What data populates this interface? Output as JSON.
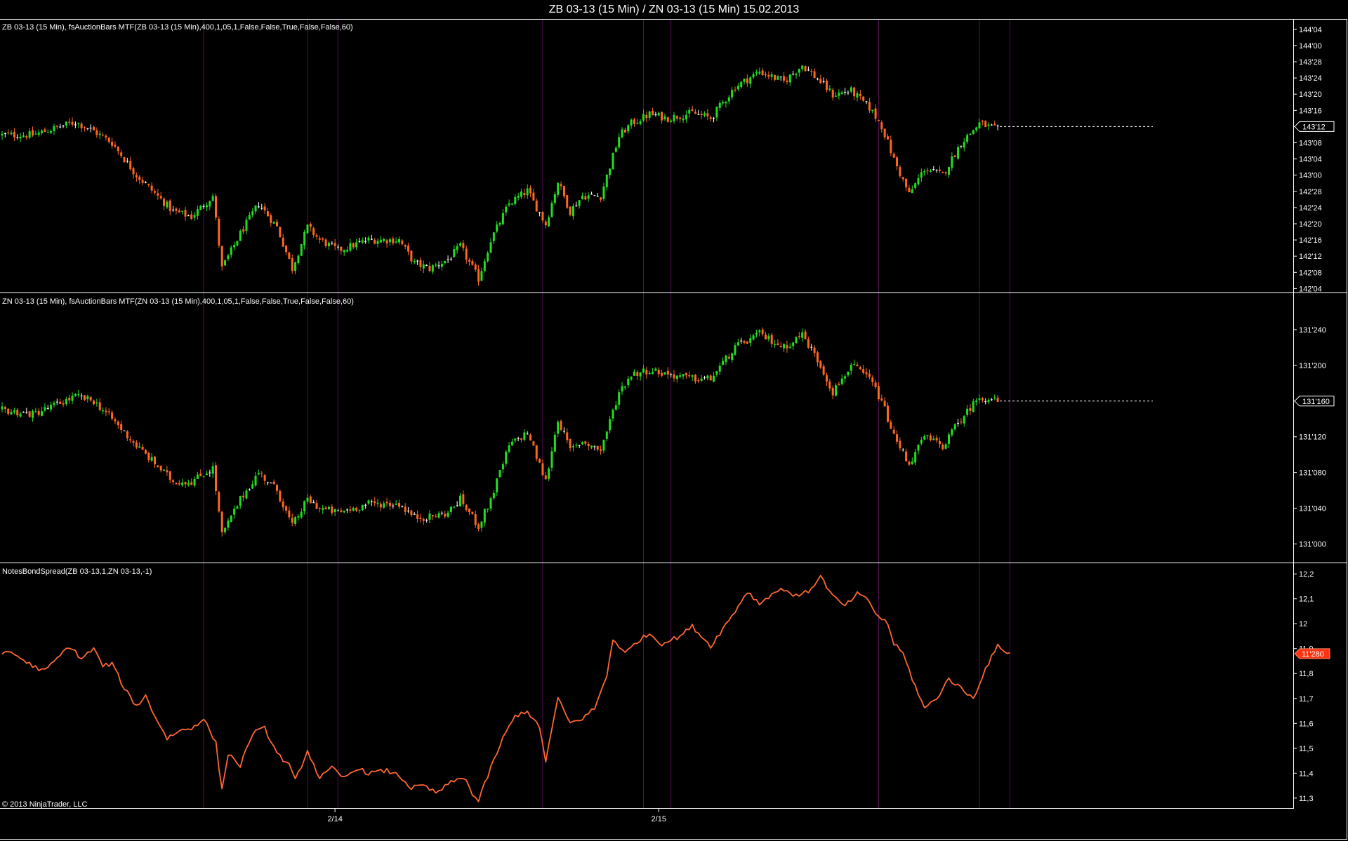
{
  "window": {
    "title": "ZB 03-13 (15 Min) / ZN 03-13 (15 Min)  15.02.2013"
  },
  "colors": {
    "background": "#000000",
    "border": "#ffffff",
    "separator": "#551155",
    "up_bar": "#22dd22",
    "down_bar": "#ff6622",
    "neutral_bar": "#ffffff",
    "spread_line": "#ff6633",
    "spread_marker_bg": "#ff3311"
  },
  "copyright": "© 2013 NinjaTrader, LLC",
  "x_axis": {
    "labels": [
      {
        "text": "2/14",
        "index": 109
      },
      {
        "text": "2/15",
        "index": 215
      }
    ],
    "session_separators": [
      66,
      100,
      110,
      177,
      210,
      219,
      287,
      320,
      330
    ]
  },
  "chart_data": [
    {
      "type": "candlestick",
      "name": "ZB 03-13 (15 Min), fsAuctionBars MTF(ZB 03-13 (15 Min),400,1,05,1,False,False,True,False,False,60)",
      "ylim": [
        142.1,
        144.2
      ],
      "tick_values": [
        142.125,
        142.25,
        142.375,
        142.5,
        142.625,
        142.75,
        142.875,
        143.0,
        143.125,
        143.25,
        143.375,
        143.5,
        143.625,
        143.75,
        143.875,
        144.0,
        144.125
      ],
      "tick_labels": [
        "142'04",
        "142'08",
        "142'12",
        "142'16",
        "142'20",
        "142'24",
        "142'28",
        "143'00",
        "143'04",
        "143'08",
        "143'12",
        "143'16",
        "143'20",
        "143'24",
        "143'28",
        "144'00",
        "144'04"
      ],
      "last_price": 143.375,
      "last_label": "143'12",
      "keys": [
        [
          0,
          143.31
        ],
        [
          10,
          143.31
        ],
        [
          24,
          143.41
        ],
        [
          30,
          143.34
        ],
        [
          36,
          143.25
        ],
        [
          44,
          143.0
        ],
        [
          56,
          142.72
        ],
        [
          62,
          142.68
        ],
        [
          69,
          142.84
        ],
        [
          72,
          142.28
        ],
        [
          78,
          142.55
        ],
        [
          84,
          142.78
        ],
        [
          90,
          142.6
        ],
        [
          95,
          142.28
        ],
        [
          100,
          142.6
        ],
        [
          104,
          142.5
        ],
        [
          110,
          142.42
        ],
        [
          120,
          142.5
        ],
        [
          130,
          142.5
        ],
        [
          135,
          142.32
        ],
        [
          140,
          142.28
        ],
        [
          146,
          142.35
        ],
        [
          150,
          142.45
        ],
        [
          156,
          142.2
        ],
        [
          160,
          142.5
        ],
        [
          166,
          142.78
        ],
        [
          172,
          142.88
        ],
        [
          178,
          142.62
        ],
        [
          182,
          142.95
        ],
        [
          186,
          142.72
        ],
        [
          190,
          142.84
        ],
        [
          196,
          142.84
        ],
        [
          202,
          143.3
        ],
        [
          206,
          143.4
        ],
        [
          212,
          143.47
        ],
        [
          218,
          143.44
        ],
        [
          226,
          143.48
        ],
        [
          232,
          143.44
        ],
        [
          240,
          143.68
        ],
        [
          248,
          143.8
        ],
        [
          256,
          143.72
        ],
        [
          262,
          143.85
        ],
        [
          268,
          143.72
        ],
        [
          272,
          143.62
        ],
        [
          278,
          143.65
        ],
        [
          284,
          143.52
        ],
        [
          288,
          143.38
        ],
        [
          292,
          143.12
        ],
        [
          297,
          142.85
        ],
        [
          302,
          143.05
        ],
        [
          308,
          143.0
        ],
        [
          314,
          143.25
        ],
        [
          320,
          143.4
        ],
        [
          326,
          143.35
        ]
      ],
      "last_index": 326
    },
    {
      "type": "candlestick",
      "name": "ZN 03-13 (15 Min), fsAuctionBars MTF(ZN 03-13 (15 Min),400,1,05,1,False,False,True,False,False,60)",
      "ylim": [
        130.98,
        131.28
      ],
      "tick_values": [
        131.0,
        131.04,
        131.08,
        131.12,
        131.16,
        131.2,
        131.24
      ],
      "tick_labels": [
        "131'000",
        "131'040",
        "131'080",
        "131'120",
        "131'160",
        "131'200",
        "131'240"
      ],
      "last_price": 131.16,
      "last_label": "131'160",
      "keys": [
        [
          0,
          131.15
        ],
        [
          10,
          131.145
        ],
        [
          24,
          131.165
        ],
        [
          30,
          131.16
        ],
        [
          36,
          131.14
        ],
        [
          44,
          131.11
        ],
        [
          56,
          131.07
        ],
        [
          62,
          131.07
        ],
        [
          69,
          131.085
        ],
        [
          72,
          131.01
        ],
        [
          78,
          131.05
        ],
        [
          84,
          131.08
        ],
        [
          90,
          131.06
        ],
        [
          95,
          131.02
        ],
        [
          100,
          131.05
        ],
        [
          104,
          131.04
        ],
        [
          110,
          131.035
        ],
        [
          120,
          131.045
        ],
        [
          130,
          131.045
        ],
        [
          135,
          131.03
        ],
        [
          140,
          131.03
        ],
        [
          146,
          131.035
        ],
        [
          150,
          131.05
        ],
        [
          156,
          131.02
        ],
        [
          160,
          131.05
        ],
        [
          166,
          131.11
        ],
        [
          172,
          131.125
        ],
        [
          178,
          131.07
        ],
        [
          182,
          131.14
        ],
        [
          186,
          131.105
        ],
        [
          190,
          131.115
        ],
        [
          196,
          131.105
        ],
        [
          202,
          131.17
        ],
        [
          206,
          131.19
        ],
        [
          212,
          131.195
        ],
        [
          218,
          131.19
        ],
        [
          226,
          131.185
        ],
        [
          232,
          131.185
        ],
        [
          240,
          131.22
        ],
        [
          248,
          131.235
        ],
        [
          256,
          131.22
        ],
        [
          262,
          131.235
        ],
        [
          268,
          131.2
        ],
        [
          272,
          131.17
        ],
        [
          278,
          131.2
        ],
        [
          284,
          131.185
        ],
        [
          288,
          131.16
        ],
        [
          292,
          131.12
        ],
        [
          297,
          131.09
        ],
        [
          302,
          131.12
        ],
        [
          308,
          131.11
        ],
        [
          314,
          131.14
        ],
        [
          320,
          131.165
        ],
        [
          326,
          131.16
        ]
      ],
      "last_index": 326
    },
    {
      "type": "line",
      "name": "NotesBondSpread(ZB 03-13,1,ZN 03-13,-1)",
      "ylim": [
        11.26,
        12.24
      ],
      "tick_values": [
        11.3,
        11.4,
        11.5,
        11.6,
        11.7,
        11.8,
        11.9,
        12.0,
        12.1,
        12.2
      ],
      "tick_labels": [
        "11,3",
        "11,4",
        "11,5",
        "11,6",
        "11,7",
        "11,8",
        "11,9",
        "12",
        "12,1",
        "12,2"
      ],
      "last_value": 11.88,
      "last_label": "11'280",
      "keys": [
        [
          0,
          11.87
        ],
        [
          2,
          11.89
        ],
        [
          5,
          11.87
        ],
        [
          10,
          11.83
        ],
        [
          14,
          11.81
        ],
        [
          18,
          11.86
        ],
        [
          22,
          11.91
        ],
        [
          26,
          11.86
        ],
        [
          30,
          11.9
        ],
        [
          33,
          11.83
        ],
        [
          36,
          11.84
        ],
        [
          40,
          11.74
        ],
        [
          44,
          11.67
        ],
        [
          47,
          11.71
        ],
        [
          50,
          11.63
        ],
        [
          54,
          11.54
        ],
        [
          58,
          11.57
        ],
        [
          62,
          11.58
        ],
        [
          66,
          11.62
        ],
        [
          70,
          11.52
        ],
        [
          72,
          11.33
        ],
        [
          74,
          11.48
        ],
        [
          78,
          11.43
        ],
        [
          82,
          11.56
        ],
        [
          86,
          11.58
        ],
        [
          90,
          11.48
        ],
        [
          94,
          11.43
        ],
        [
          96,
          11.37
        ],
        [
          100,
          11.49
        ],
        [
          104,
          11.38
        ],
        [
          108,
          11.42
        ],
        [
          112,
          11.38
        ],
        [
          116,
          11.42
        ],
        [
          120,
          11.4
        ],
        [
          126,
          11.41
        ],
        [
          130,
          11.39
        ],
        [
          134,
          11.34
        ],
        [
          138,
          11.35
        ],
        [
          142,
          11.32
        ],
        [
          148,
          11.37
        ],
        [
          152,
          11.38
        ],
        [
          154,
          11.31
        ],
        [
          156,
          11.29
        ],
        [
          160,
          11.42
        ],
        [
          164,
          11.54
        ],
        [
          168,
          11.63
        ],
        [
          172,
          11.65
        ],
        [
          176,
          11.58
        ],
        [
          178,
          11.45
        ],
        [
          182,
          11.7
        ],
        [
          186,
          11.6
        ],
        [
          190,
          11.62
        ],
        [
          194,
          11.66
        ],
        [
          198,
          11.79
        ],
        [
          200,
          11.94
        ],
        [
          204,
          11.88
        ],
        [
          208,
          11.93
        ],
        [
          212,
          11.96
        ],
        [
          216,
          11.92
        ],
        [
          222,
          11.95
        ],
        [
          226,
          11.99
        ],
        [
          232,
          11.91
        ],
        [
          236,
          11.98
        ],
        [
          240,
          12.05
        ],
        [
          244,
          12.13
        ],
        [
          248,
          12.08
        ],
        [
          252,
          12.12
        ],
        [
          256,
          12.14
        ],
        [
          260,
          12.11
        ],
        [
          264,
          12.13
        ],
        [
          268,
          12.19
        ],
        [
          272,
          12.11
        ],
        [
          276,
          12.07
        ],
        [
          280,
          12.12
        ],
        [
          284,
          12.09
        ],
        [
          286,
          12.04
        ],
        [
          290,
          12.0
        ],
        [
          292,
          11.92
        ],
        [
          295,
          11.88
        ],
        [
          298,
          11.78
        ],
        [
          302,
          11.66
        ],
        [
          306,
          11.7
        ],
        [
          310,
          11.78
        ],
        [
          314,
          11.74
        ],
        [
          318,
          11.7
        ],
        [
          322,
          11.82
        ],
        [
          326,
          11.91
        ],
        [
          330,
          11.88
        ]
      ],
      "last_index": 330
    }
  ]
}
